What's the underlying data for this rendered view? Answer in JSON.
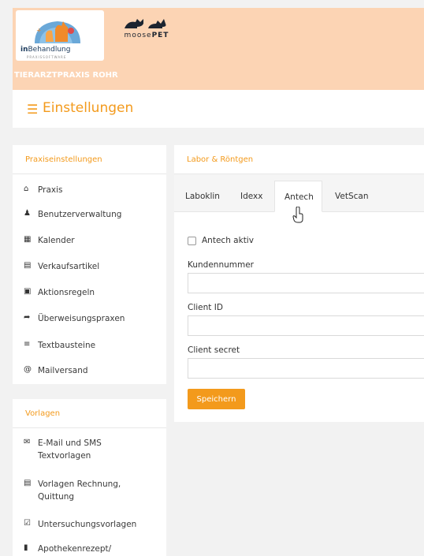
{
  "header": {
    "logo_text_bold": "in",
    "logo_text_rest": "Behandlung",
    "logo_subtext": "PRAXISSOFTWARE",
    "partner_logo_text_a": "moose",
    "partner_logo_text_b": "PET",
    "practice_name": "TIERARZTPRAXIS ROHR",
    "colors": {
      "header_bg": "#fcd4b4",
      "accent": "#f39a1c"
    }
  },
  "titlebar": {
    "menu_icon": "hamburger-icon",
    "title": "Einstellungen"
  },
  "sidebar": {
    "section_title": "Praxiseinstellungen",
    "items": [
      {
        "icon": "home-icon",
        "label": "Praxis"
      },
      {
        "icon": "users-gear-icon",
        "label": "Benutzerverwaltung"
      },
      {
        "icon": "calendar-icon",
        "label": "Kalender"
      },
      {
        "icon": "cart-icon",
        "label": "Verkaufsartikel"
      },
      {
        "icon": "robot-icon",
        "label": "Aktionsregeln"
      },
      {
        "icon": "share-icon",
        "label": "Überweisungspraxen"
      },
      {
        "icon": "text-lines-icon",
        "label": "Textbausteine"
      },
      {
        "icon": "at-icon",
        "label": "Mailversand"
      }
    ]
  },
  "templates": {
    "section_title": "Vorlagen",
    "items": [
      {
        "icon": "envelope-icon",
        "line1": "E-Mail und SMS",
        "line2": "Textvorlagen"
      },
      {
        "icon": "receipt-icon",
        "line1": "Vorlagen Rechnung,",
        "line2": "Quittung"
      },
      {
        "icon": "checkbox-icon",
        "line1": "Untersuchungsvorlagen",
        "line2": ""
      },
      {
        "icon": "file-icon",
        "line1": "Apothekenrezept/",
        "line2": ""
      }
    ]
  },
  "main": {
    "section_title": "Labor & Röntgen",
    "tabs": [
      "Laboklin",
      "Idexx",
      "Antech",
      "VetScan"
    ],
    "active_tab": "Antech",
    "checkbox_label": "Antech aktiv",
    "checkbox_checked": false,
    "fields": [
      {
        "label": "Kundennummer",
        "value": ""
      },
      {
        "label": "Client ID",
        "value": ""
      },
      {
        "label": "Client secret",
        "value": ""
      }
    ],
    "save_label": "Speichern"
  }
}
